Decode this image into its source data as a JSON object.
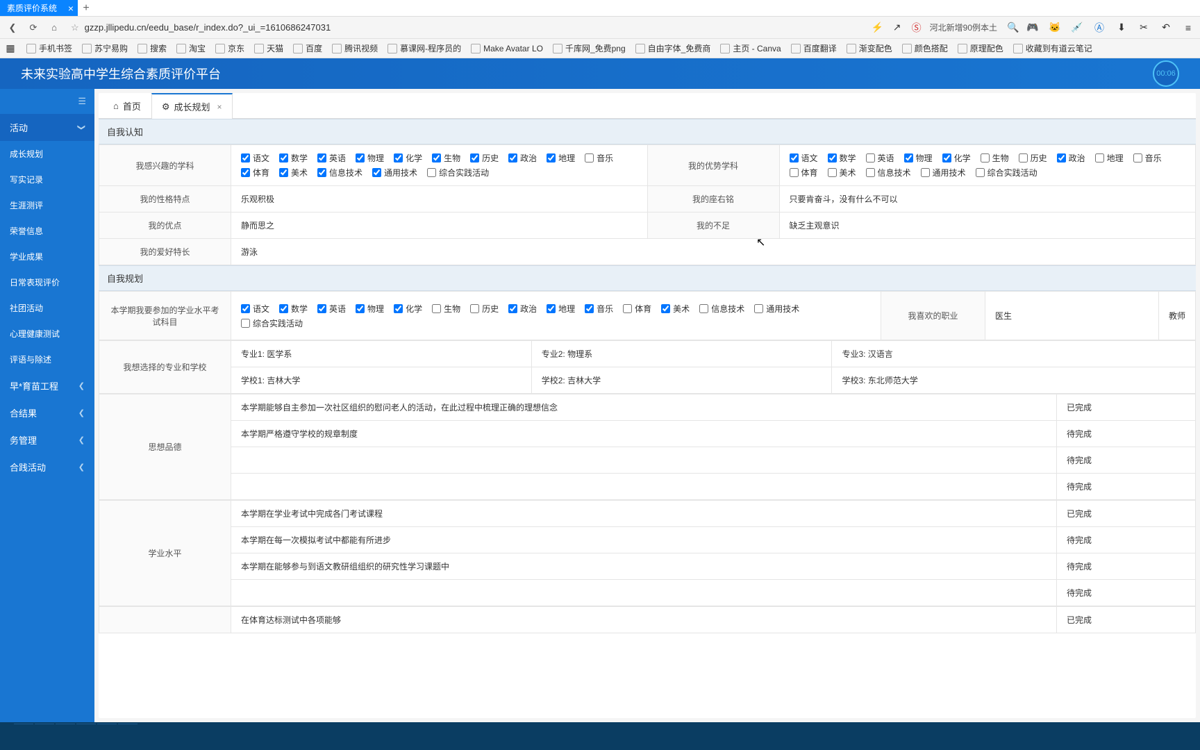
{
  "browser": {
    "tab_title": "素质评价系统",
    "url": "gzzp.jllipedu.cn/eedu_base/r_index.do?_ui_=1610686247031",
    "search_hint": "河北新增90例本土"
  },
  "bookmarks": [
    "手机书签",
    "苏宁易购",
    "搜索",
    "淘宝",
    "京东",
    "天猫",
    "百度",
    "腾讯视频",
    "慕课网-程序员的",
    "Make Avatar LO",
    "千库网_免费png",
    "自由字体_免费商",
    "主页 - Canva",
    "百度翻译",
    "渐变配色",
    "颜色搭配",
    "原理配色",
    "收藏到有道云笔记"
  ],
  "app": {
    "title": "未来实验高中学生综合素质评价平台",
    "timer": "00:06"
  },
  "sidebar": {
    "group": "活动",
    "items": [
      "成长规划",
      "写实记录",
      "生涯测评",
      "荣誉信息",
      "学业成果",
      "日常表现评价",
      "社团活动",
      "心理健康测试",
      "评语与除述"
    ],
    "groups2": [
      "早*育苗工程",
      "合结果",
      "务管理",
      "合践活动"
    ]
  },
  "tabs": {
    "home": "首页",
    "plan": "成长规划"
  },
  "sec1": "自我认知",
  "sec2": "自我规划",
  "labels": {
    "interest": "我感兴趣的学科",
    "advantage": "我的优势学科",
    "personality": "我的性格特点",
    "motto": "我的座右铭",
    "strength": "我的优点",
    "weakness": "我的不足",
    "hobby": "我的爱好特长",
    "exam": "本学期我要参加的学业水平考试科目",
    "career": "我喜欢的职业",
    "career1": "医生",
    "career2": "教师",
    "major": "我想选择的专业和学校",
    "moral": "思想品德",
    "academic": "学业水平"
  },
  "subjects": [
    "语文",
    "数学",
    "英语",
    "物理",
    "化学",
    "生物",
    "历史",
    "政治",
    "地理",
    "音乐",
    "体育",
    "美术",
    "信息技术",
    "通用技术",
    "综合实践活动"
  ],
  "interest_checked": [
    true,
    true,
    true,
    true,
    true,
    true,
    true,
    true,
    true,
    false,
    true,
    true,
    true,
    true,
    false
  ],
  "advantage_checked": [
    true,
    true,
    false,
    true,
    true,
    false,
    false,
    true,
    false,
    false,
    false,
    false,
    false,
    false,
    false
  ],
  "exam_checked": [
    true,
    true,
    true,
    true,
    true,
    false,
    false,
    true,
    true,
    true,
    false,
    true,
    false,
    false,
    false
  ],
  "vals": {
    "personality": "乐观积极",
    "motto": "只要肯奋斗，没有什么不可以",
    "strength": "静而思之",
    "weakness": "缺乏主观意识",
    "hobby": "游泳"
  },
  "majors": {
    "m1l": "专业1:",
    "m1": "医学系",
    "s1l": "学校1:",
    "s1": "吉林大学",
    "m2l": "专业2:",
    "m2": "物理系",
    "s2l": "学校2:",
    "s2": "吉林大学",
    "m3l": "专业3:",
    "m3": "汉语言",
    "s3l": "学校3:",
    "s3": "东北师范大学"
  },
  "moral_rows": [
    {
      "text": "本学期能够自主参加一次社区组织的慰问老人的活动，在此过程中梳理正确的理想信念",
      "status": "已完成"
    },
    {
      "text": "本学期严格遵守学校的规章制度",
      "status": "待完成"
    },
    {
      "text": "",
      "status": "待完成"
    },
    {
      "text": "",
      "status": "待完成"
    }
  ],
  "academic_rows": [
    {
      "text": "本学期在学业考试中完成各门考试课程",
      "status": "已完成"
    },
    {
      "text": "本学期在每一次模拟考试中都能有所进步",
      "status": "待完成"
    },
    {
      "text": "本学期在能够参与到语文教研组组织的研究性学习课题中",
      "status": "待完成"
    },
    {
      "text": "",
      "status": "待完成"
    }
  ],
  "last_block": [
    {
      "text": "在体育达标测试中各项能够",
      "status": "已完成"
    }
  ]
}
